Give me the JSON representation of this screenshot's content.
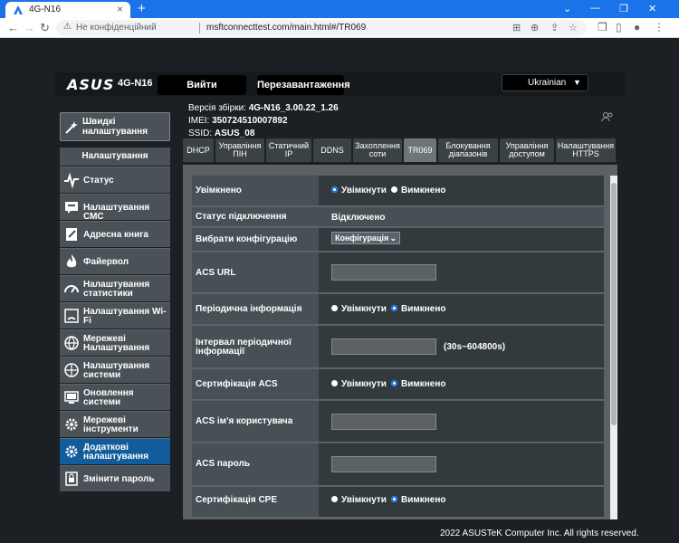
{
  "browser": {
    "tab_title": "4G-N16",
    "not_secure": "Не конфіденційний",
    "url": "msftconnecttest.com/main.html#/TR069"
  },
  "header": {
    "logo": "ASUS",
    "model": "4G-N16",
    "login_button": "Вийти",
    "reboot_button": "Перезавантаження",
    "language": "Ukrainian"
  },
  "info": {
    "firmware_label": "Версія збірки:",
    "firmware_value": "4G-N16_3.00.22_1.26",
    "imei_label": "IMEI:",
    "imei_value": "350724510007892",
    "ssid_label": "SSID:",
    "ssid_value": "ASUS_08"
  },
  "sidebar": {
    "quick_setup": "Швидкі налаштування",
    "section_header": "Налаштування",
    "items": [
      {
        "label": "Статус"
      },
      {
        "label": "Налаштування СМС"
      },
      {
        "label": "Адресна книга"
      },
      {
        "label": "Файервол"
      },
      {
        "label": "Налаштування статистики"
      },
      {
        "label": "Налаштування Wi-Fi"
      },
      {
        "label": "Мережеві Налаштування"
      },
      {
        "label": "Налаштування системи"
      },
      {
        "label": "Оновлення системи"
      },
      {
        "label": "Мережеві інструменти"
      },
      {
        "label": "Додаткові налаштування",
        "active": true
      },
      {
        "label": "Змінити пароль"
      }
    ]
  },
  "subtabs": [
    {
      "label": "DHCP"
    },
    {
      "label": "Управління ПІН"
    },
    {
      "label": "Статичний IP"
    },
    {
      "label": "DDNS"
    },
    {
      "label": "Захоплення соти"
    },
    {
      "label": "TR069",
      "active": true
    },
    {
      "label": "Блокування діапазонів"
    },
    {
      "label": "Управління доступом"
    },
    {
      "label": "Налаштування HTTPS"
    }
  ],
  "form": {
    "enabled_label": "Увімкнено",
    "on_label": "Увімкнути",
    "off_label": "Вимкнено",
    "status_label": "Статус підключення",
    "status_value": "Відключено",
    "config_label": "Вибрати конфігурацію",
    "config_value": "Конфігурація",
    "acs_url_label": "ACS URL",
    "periodic_label": "Періодична інформація",
    "interval_label": "Інтервал періодичної інформації",
    "interval_hint": "(30s~604800s)",
    "acs_cert_label": "Сертифікація ACS",
    "acs_user_label": "ACS ім'я користувача",
    "acs_pass_label": "ACS пароль",
    "cpe_cert_label": "Сертифікація CPE"
  },
  "footer": "2022 ASUSTeK Computer Inc. All rights reserved."
}
